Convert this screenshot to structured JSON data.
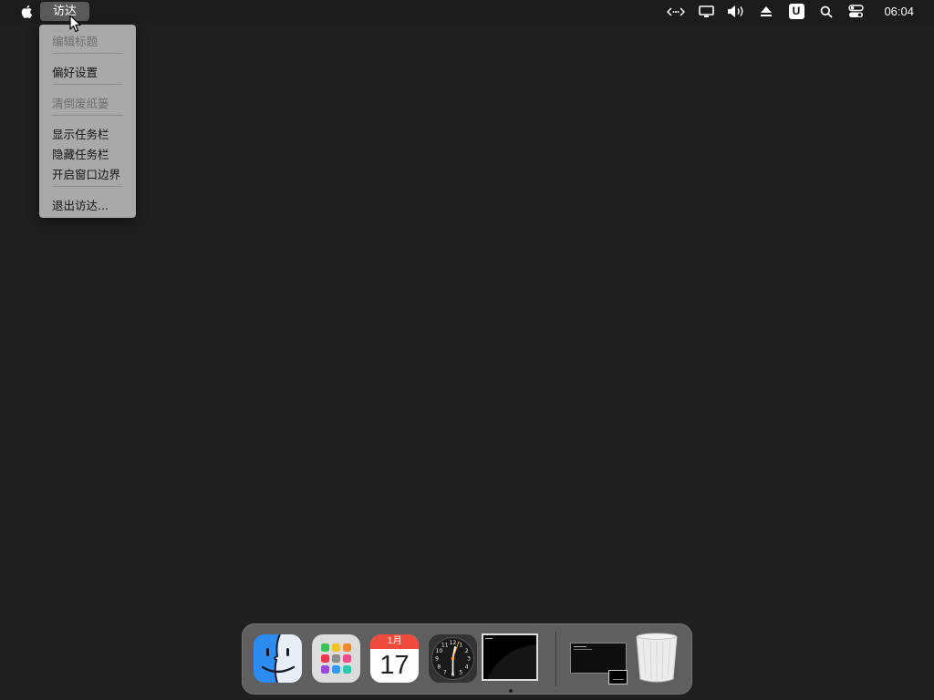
{
  "menubar": {
    "app_name": "访达",
    "clock": "06:04",
    "status_icons": [
      "network-icon",
      "display-icon",
      "volume-icon",
      "eject-icon",
      "input-method-icon",
      "search-icon",
      "control-center-icon"
    ],
    "input_method_label": "U"
  },
  "dropdown": {
    "items": [
      {
        "label": "编辑标题",
        "enabled": false
      },
      {
        "label": "偏好设置",
        "enabled": true
      },
      {
        "label": "清倒废纸篓",
        "enabled": false
      },
      {
        "label": "显示任务栏",
        "enabled": true
      },
      {
        "label": "隐藏任务栏",
        "enabled": true
      },
      {
        "label": "开启窗口边界",
        "enabled": true
      },
      {
        "label": "退出访达...",
        "enabled": true
      }
    ]
  },
  "dock": {
    "items": [
      "finder",
      "launchpad",
      "calendar",
      "clock",
      "terminal-window",
      "minimized-window",
      "trash"
    ],
    "calendar_month": "1月",
    "calendar_day": "17",
    "clock_numbers": [
      "12",
      "1",
      "2",
      "3",
      "4",
      "5",
      "6",
      "7",
      "8",
      "9",
      "10",
      "11"
    ]
  },
  "colors": {
    "desktop": "#1f1f1f",
    "menubar": "#1c1c1c",
    "menu_bg": "#a9a9a9",
    "dock_bg": "#5f5f5f",
    "finder_blue": "#2d8cf0",
    "calendar_red": "#f04b3c"
  }
}
